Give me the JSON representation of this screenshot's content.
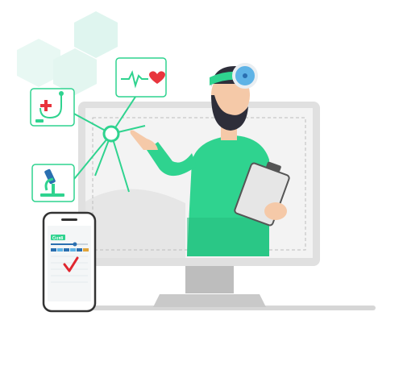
{
  "colors": {
    "accent_green": "#2fd38f",
    "teal_light": "#dff5ef",
    "monitor_gray": "#e0e0e0",
    "screen_gray": "#ececec",
    "heart_red": "#e8353d",
    "check_red": "#e0262f",
    "phone_blue": "#2a6fb0",
    "skin": "#f5c9a8",
    "beard": "#2e2e3a"
  },
  "icons": [
    "heartbeat-icon",
    "stethoscope-icon",
    "microscope-icon",
    "checkmark-icon"
  ],
  "phone": {
    "badge_text": "Ⴀ৫¤8",
    "progress": 0.65
  }
}
